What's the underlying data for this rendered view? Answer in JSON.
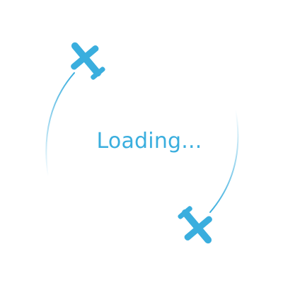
{
  "loader": {
    "text": "Loading...",
    "accent_color": "#3aaede",
    "icons": [
      "airplane-icon",
      "airplane-icon"
    ]
  }
}
